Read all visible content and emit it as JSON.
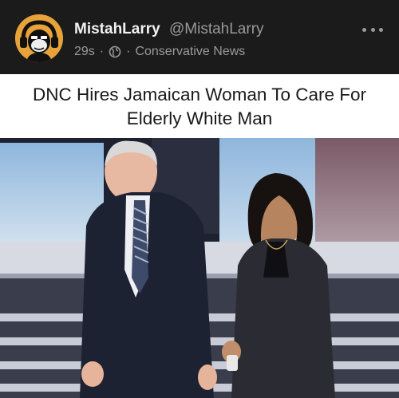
{
  "post": {
    "author_name": "MistahLarry",
    "author_handle": "@MistahLarry",
    "time": "29s",
    "separator": "·",
    "audience_icon": "globe-icon",
    "group": "Conservative News",
    "more_icon": "more-horizontal-icon"
  },
  "meme": {
    "caption_line1": "DNC Hires Jamaican Woman To Care For",
    "caption_line2": "Elderly White Man"
  },
  "colors": {
    "background": "#1b1b1b",
    "author_text": "#f2f2f2",
    "muted_text": "#9a9a9a",
    "avatar_bg": "#e8a23a"
  }
}
